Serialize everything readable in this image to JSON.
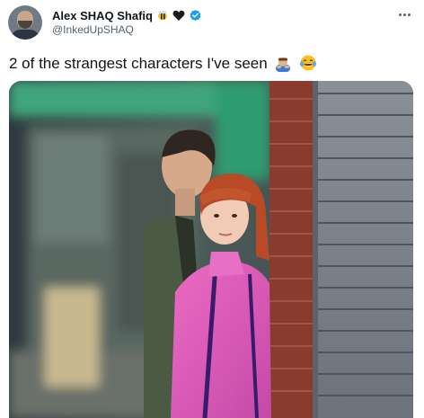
{
  "author": {
    "display_name": "Alex SHAQ Shafiq",
    "handle": "@InkedUpSHAQ",
    "name_emojis": [
      "bee-emoji",
      "black-heart-emoji"
    ],
    "verified": true
  },
  "tweet": {
    "text": "2 of the strangest characters I've seen",
    "trailing_emojis": [
      "man-bowing-emoji",
      "face-with-tears-of-joy-emoji"
    ]
  },
  "colors": {
    "text_primary": "#0f1419",
    "text_secondary": "#536471",
    "verified_blue": "#1d9bf0"
  }
}
